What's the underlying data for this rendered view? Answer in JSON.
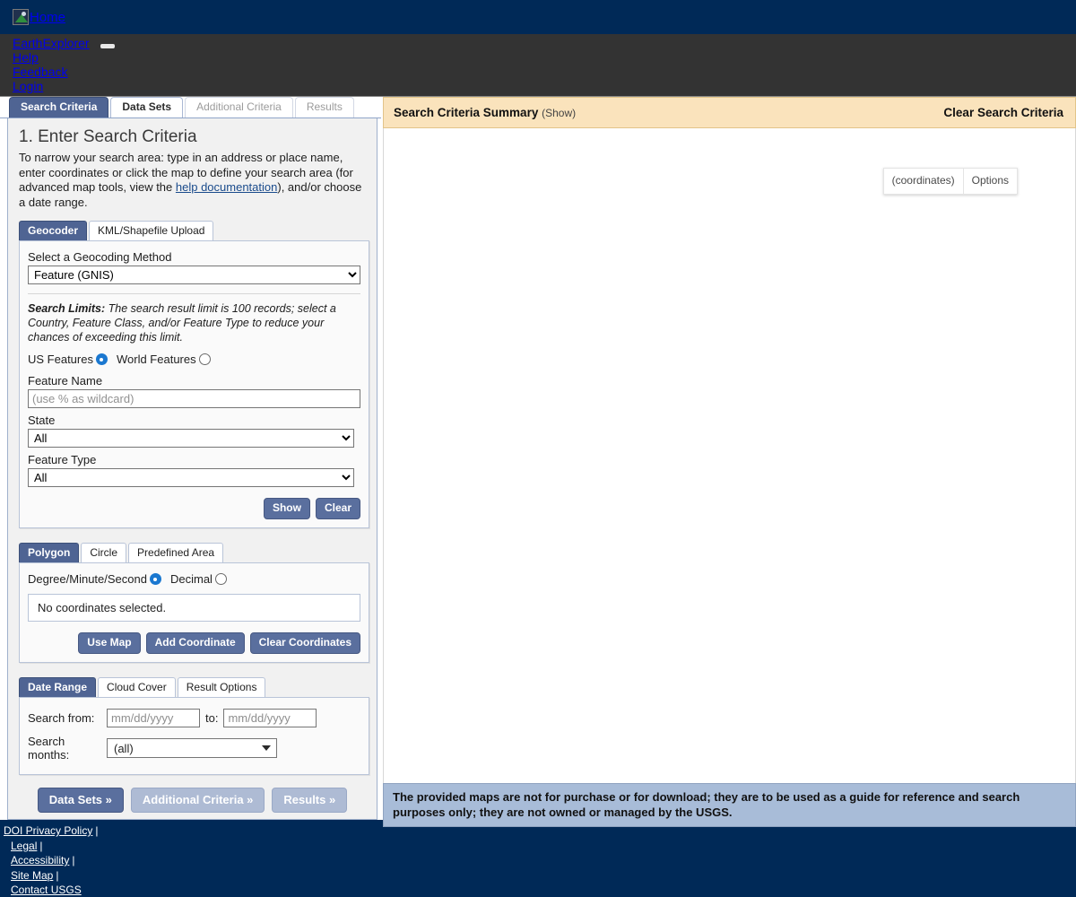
{
  "banner": {
    "home_label": "Home",
    "home_icon": "broken-image-icon"
  },
  "nav": {
    "items": [
      {
        "label": "EarthExplorer"
      },
      {
        "label": "Help"
      },
      {
        "label": "Feedback"
      },
      {
        "label": "Login"
      }
    ],
    "collapse_icon": "minimize-icon"
  },
  "tabs": [
    {
      "label": "Search Criteria",
      "state": "active"
    },
    {
      "label": "Data Sets",
      "state": "enabled"
    },
    {
      "label": "Additional Criteria",
      "state": "disabled"
    },
    {
      "label": "Results",
      "state": "disabled"
    }
  ],
  "step": {
    "heading": "1. Enter Search Criteria",
    "description_part1": "To narrow your search area: type in an address or place name, enter coordinates or click the map to define your search area (for advanced map tools, view the ",
    "description_link": "help documentation",
    "description_part2": "), and/or choose a date range."
  },
  "geocoder": {
    "tabs": [
      {
        "label": "Geocoder",
        "state": "active"
      },
      {
        "label": "KML/Shapefile Upload",
        "state": "enabled"
      }
    ],
    "method_label": "Select a Geocoding Method",
    "method_value": "Feature (GNIS)",
    "limits_bold": "Search Limits:",
    "limits_text": " The search result limit is 100 records; select a Country, Feature Class, and/or Feature Type to reduce your chances of exceeding this limit.",
    "scope_us_label": "US Features",
    "scope_us_checked": true,
    "scope_world_label": "World Features",
    "scope_world_checked": false,
    "feature_name_label": "Feature Name",
    "feature_name_value": "",
    "feature_name_placeholder": "(use % as wildcard)",
    "state_label": "State",
    "state_value": "All",
    "feature_type_label": "Feature Type",
    "feature_type_value": "All",
    "show_button": "Show",
    "clear_button": "Clear"
  },
  "spatial": {
    "tabs": [
      {
        "label": "Polygon",
        "state": "active"
      },
      {
        "label": "Circle",
        "state": "enabled"
      },
      {
        "label": "Predefined Area",
        "state": "enabled"
      }
    ],
    "dms_label": "Degree/Minute/Second",
    "dms_checked": true,
    "decimal_label": "Decimal",
    "decimal_checked": false,
    "coordinates_status": "No coordinates selected.",
    "use_map_button": "Use Map",
    "add_coordinate_button": "Add Coordinate",
    "clear_coordinates_button": "Clear Coordinates"
  },
  "filters": {
    "tabs": [
      {
        "label": "Date Range",
        "state": "active"
      },
      {
        "label": "Cloud Cover",
        "state": "enabled"
      },
      {
        "label": "Result Options",
        "state": "enabled"
      }
    ],
    "search_from_label": "Search from:",
    "search_from_value": "",
    "search_from_placeholder": "mm/dd/yyyy",
    "to_label": "to:",
    "search_to_value": "",
    "search_to_placeholder": "mm/dd/yyyy",
    "search_months_label": "Search months:",
    "search_months_value": "(all)"
  },
  "step_nav": {
    "data_sets": "Data Sets »",
    "additional_criteria": "Additional Criteria »",
    "results": "Results »"
  },
  "summary": {
    "title": "Search Criteria Summary",
    "show_toggle": "(Show)",
    "clear_label": "Clear Search Criteria"
  },
  "map": {
    "coordinates_button": "(coordinates)",
    "options_button": "Options",
    "notice": "The provided maps are not for purchase or for download; they are to be used as a guide for reference and search purposes only; they are not owned or managed by the USGS."
  },
  "footer": {
    "links": [
      {
        "label": "DOI Privacy Policy",
        "separator": "|"
      },
      {
        "label": "Legal",
        "separator": "|"
      },
      {
        "label": "Accessibility",
        "separator": "|"
      },
      {
        "label": "Site Map",
        "separator": "|"
      },
      {
        "label": "Contact USGS",
        "separator": ""
      }
    ]
  },
  "colors": {
    "usgs_navy": "#002957",
    "nav_dark": "#333333",
    "tab_active": "#4f6493",
    "button_blue": "#5a6f9e",
    "summary_tan": "#fae3bc",
    "notice_blue": "#a8bcd8",
    "link_blue": "#0000ee"
  }
}
